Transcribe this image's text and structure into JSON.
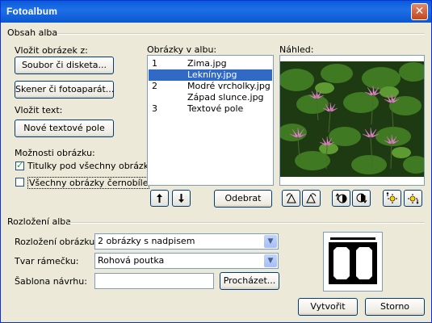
{
  "window": {
    "title": "Fotoalbum",
    "close_icon": "close-icon"
  },
  "album_content": {
    "group_label": "Obsah alba",
    "insert_picture_label": "Vložit obrázek z:",
    "file_button": "Soubor či disketa...",
    "scanner_button": "Skener či fotoaparát...",
    "insert_text_label": "Vložit text:",
    "new_textbox_button": "Nové textové pole",
    "picture_options_label": "Možnosti obrázku:",
    "captions_checkbox": {
      "label": "Titulky pod všechny obrázky",
      "checked": true
    },
    "blackwhite_checkbox": {
      "label": "Všechny obrázky černobíle",
      "checked": false
    }
  },
  "pictures": {
    "label": "Obrázky v albu:",
    "items": [
      {
        "num": "1",
        "name": "Zima.jpg",
        "selected": false
      },
      {
        "num": "",
        "name": "Lekníny.jpg",
        "selected": true
      },
      {
        "num": "2",
        "name": "Modré vrcholky.jpg",
        "selected": false
      },
      {
        "num": "",
        "name": "Západ slunce.jpg",
        "selected": false
      },
      {
        "num": "3",
        "name": "Textové pole",
        "selected": false
      }
    ],
    "remove_button": "Odebrat",
    "move_up_icon": "arrow-up-icon",
    "move_down_icon": "arrow-down-icon"
  },
  "preview": {
    "label": "Náhled:",
    "tools": [
      "rotate-left-icon",
      "rotate-right-icon",
      "contrast-up-icon",
      "contrast-down-icon",
      "brightness-up-icon",
      "brightness-down-icon"
    ]
  },
  "album_layout": {
    "group_label": "Rozložení alba",
    "picture_layout_label": "Rozložení obrázku:",
    "picture_layout_value": "2 obrázky s nadpisem",
    "frame_shape_label": "Tvar rámečku:",
    "frame_shape_value": "Rohová poutka",
    "design_template_label": "Šablona návrhu:",
    "design_template_value": "",
    "browse_button": "Procházet..."
  },
  "footer": {
    "create_button": "Vytvořit",
    "cancel_button": "Storno"
  }
}
